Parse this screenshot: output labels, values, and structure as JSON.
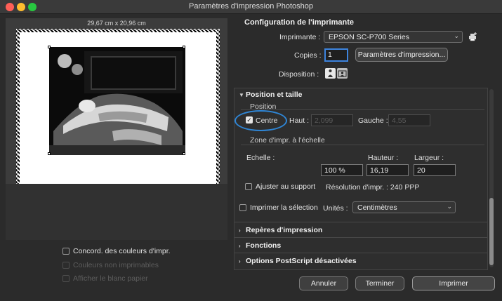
{
  "window": {
    "title": "Paramètres d'impression Photoshop"
  },
  "preview": {
    "dimensions": "29,67 cm x 20,96 cm",
    "options": [
      {
        "label": "Concord. des couleurs d'impr.",
        "enabled": true
      },
      {
        "label": "Couleurs non imprimables",
        "enabled": false
      },
      {
        "label": "Afficher le blanc papier",
        "enabled": false
      }
    ]
  },
  "printer_config": {
    "heading": "Configuration de l'imprimante",
    "printer_label": "Imprimante :",
    "printer_value": "EPSON SC-P700 Series",
    "copies_label": "Copies :",
    "copies_value": "1",
    "print_settings_button": "Paramètres d'impression...",
    "layout_label": "Disposition :"
  },
  "position_size": {
    "heading": "Position et taille",
    "position_label": "Position",
    "center_label": "Centre",
    "top_label": "Haut :",
    "top_value": "2,099",
    "left_label": "Gauche :",
    "left_value": "4,55",
    "scaled_heading": "Zone d'impr. à l'échelle",
    "scale_label": "Echelle :",
    "scale_value": "100 %",
    "height_label": "Hauteur :",
    "height_value": "16,19",
    "width_label": "Largeur :",
    "width_value": "20",
    "fit_label": "Ajuster au support",
    "resolution_text": "Résolution d'impr. : 240 PPP",
    "print_selection_label": "Imprimer la sélection",
    "units_label": "Unités :",
    "units_value": "Centimètres"
  },
  "sections": [
    {
      "label": "Repères d'impression"
    },
    {
      "label": "Fonctions"
    },
    {
      "label": "Options PostScript désactivées"
    }
  ],
  "buttons": {
    "cancel": "Annuler",
    "done": "Terminer",
    "print": "Imprimer"
  },
  "colors": {
    "accent": "#2f86d6",
    "background": "#2b2b2b"
  }
}
